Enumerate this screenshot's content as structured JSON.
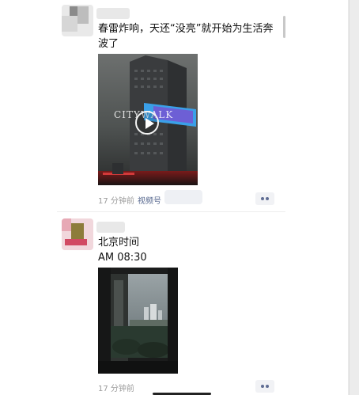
{
  "posts": [
    {
      "text": "春雷炸响，天还“没亮”就开始为生活奔波了",
      "media_type": "video",
      "overlay_text": "CITYWALK",
      "time": "17 分钟前",
      "source": "视频号"
    },
    {
      "text_line1": "北京时间",
      "text_line2": "AM 08:30",
      "media_type": "image",
      "time": "17 分钟前"
    }
  ],
  "icons": {
    "more": "more-dots-icon",
    "play": "play-icon"
  },
  "colors": {
    "link": "#56678e",
    "meta": "#9a9a9a",
    "more_button_bg": "#f1f2f5"
  }
}
